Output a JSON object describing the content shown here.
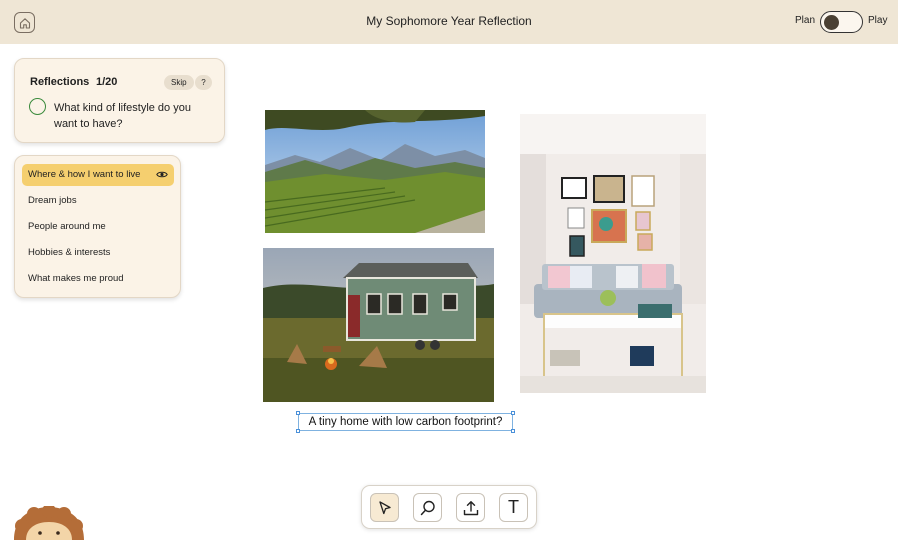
{
  "header": {
    "title": "My Sophomore Year Reflection",
    "mode_left": "Plan",
    "mode_right": "Play",
    "home_icon": "home-icon"
  },
  "reflections": {
    "title": "Reflections",
    "count": "1/20",
    "skip_label": "Skip",
    "help_label": "?",
    "question": "What kind of lifestyle do you want to have?"
  },
  "categories": [
    {
      "label": "Where & how I want to live",
      "active": true
    },
    {
      "label": "Dream jobs"
    },
    {
      "label": "People around me"
    },
    {
      "label": "Hobbies & interests"
    },
    {
      "label": "What makes me proud"
    }
  ],
  "board": {
    "caption": "A tiny home with low carbon footprint?"
  },
  "toolbar": {
    "tools": [
      "pointer-icon",
      "search-icon",
      "upload-icon",
      "text-icon"
    ],
    "text_tool_label": "T"
  },
  "colors": {
    "header_bg": "#efe6d5",
    "card_bg": "#fbf3e7",
    "active_category": "#f5cf6f",
    "question_circle": "#3a8a3c"
  }
}
